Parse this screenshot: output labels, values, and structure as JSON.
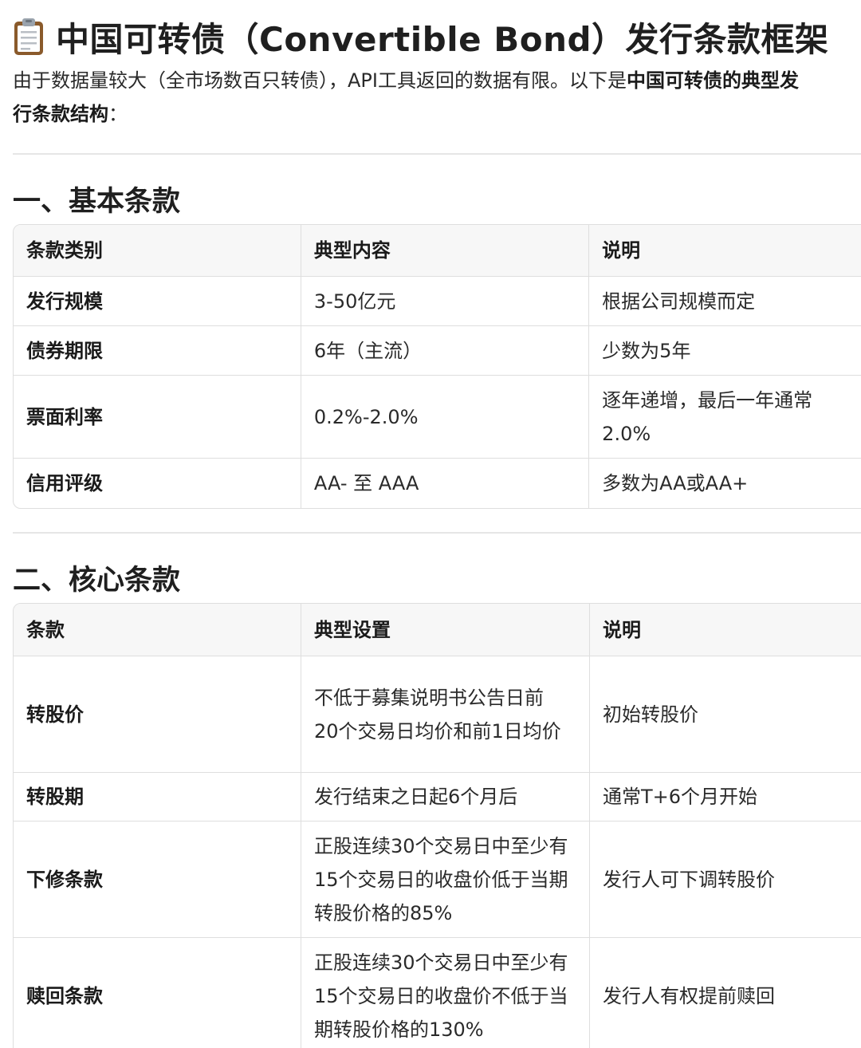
{
  "header": {
    "title": "中国可转债（Convertible Bond）发行条款框架",
    "icon": "clipboard-icon"
  },
  "intro": {
    "line1_plain": "由于数据量较大（全市场数百只转债），API工具返回的数据有限。以下是",
    "line1_bold": "中国可转债的典型发",
    "line2_bold": "行条款结构",
    "line2_plain": "："
  },
  "sections": [
    {
      "heading": "一、基本条款",
      "headers": [
        "条款类别",
        "典型内容",
        "说明"
      ],
      "rows": [
        [
          "发行规模",
          "3-50亿元",
          "根据公司规模而定"
        ],
        [
          "债券期限",
          "6年（主流）",
          "少数为5年"
        ],
        [
          "票面利率",
          "0.2%-2.0%",
          "逐年递增，最后一年通常2.0%"
        ],
        [
          "信用评级",
          "AA- 至 AAA",
          "多数为AA或AA+"
        ]
      ]
    },
    {
      "heading": "二、核心条款",
      "headers": [
        "条款",
        "典型设置",
        "说明"
      ],
      "rows": [
        [
          "转股价",
          "不低于募集说明书公告日前20个交易日均价和前1日均价",
          "初始转股价"
        ],
        [
          "转股期",
          "发行结束之日起6个月后",
          "通常T+6个月开始"
        ],
        [
          "下修条款",
          "正股连续30个交易日中至少有15个交易日的收盘价低于当期转股价格的85%",
          "发行人可下调转股价"
        ],
        [
          "赎回条款",
          "正股连续30个交易日中至少有15个交易日的收盘价不低于当期转股价格的130%",
          "发行人有权提前赎回"
        ]
      ]
    }
  ]
}
